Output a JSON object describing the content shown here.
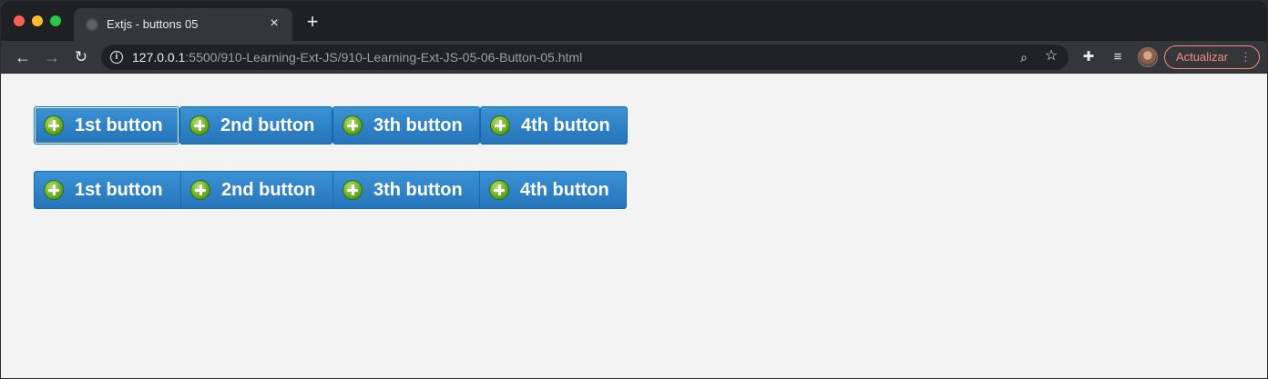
{
  "browser": {
    "tab": {
      "title": "Extjs - buttons 05",
      "close": "×"
    },
    "new_tab": "+",
    "nav": {
      "back": "←",
      "forward": "→",
      "reload": "↻"
    },
    "address": {
      "host": "127.0.0.1",
      "rest": ":5500/910-Learning-Ext-JS/910-Learning-Ext-JS-05-06-Button-05.html",
      "info": "i"
    },
    "zoom_icon": "⌕",
    "star_icon": "☆",
    "extensions_icon": "✚",
    "media_icon": "≡",
    "update": {
      "label": "Actualizar",
      "menu": "⋮"
    }
  },
  "content": {
    "row1": [
      {
        "label": "1st button"
      },
      {
        "label": "2nd button"
      },
      {
        "label": "3th button"
      },
      {
        "label": "4th button"
      }
    ],
    "row2": [
      {
        "label": "1st button"
      },
      {
        "label": "2nd button"
      },
      {
        "label": "3th button"
      },
      {
        "label": "4th button"
      }
    ]
  },
  "colors": {
    "button_top": "#3a92d4",
    "button_bottom": "#2674b9",
    "button_border": "#126daf",
    "icon_green": "#6aae22",
    "update_accent": "#f28b82"
  },
  "icons": {
    "button_icon": "add-circle-icon"
  }
}
